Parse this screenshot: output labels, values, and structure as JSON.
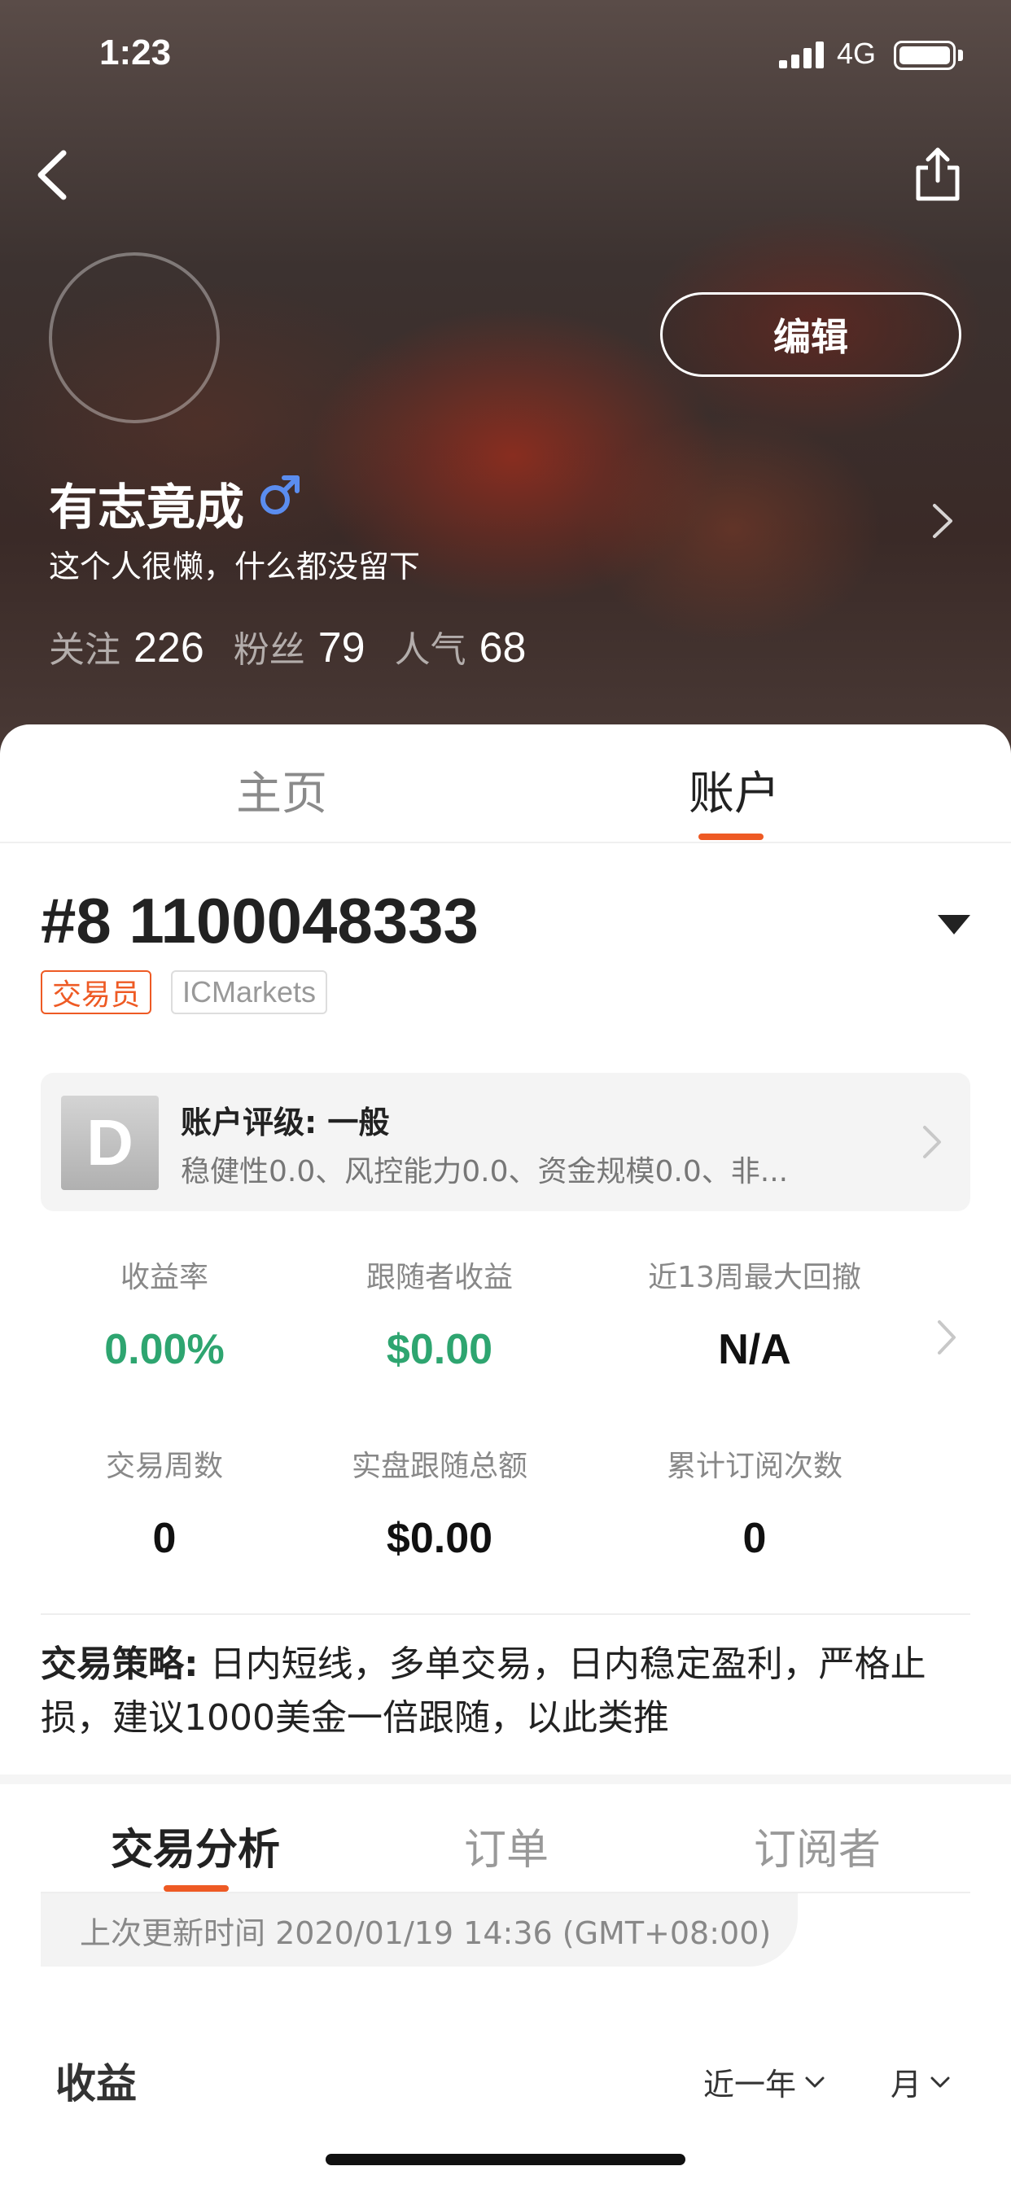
{
  "status_bar": {
    "time": "1:23",
    "network": "4G"
  },
  "profile": {
    "edit_label": "编辑",
    "name": "有志竟成",
    "bio": "这个人很懒，什么都没留下",
    "stats": [
      {
        "label": "关注",
        "value": "226"
      },
      {
        "label": "粉丝",
        "value": "79"
      },
      {
        "label": "人气",
        "value": "68"
      }
    ]
  },
  "main_tabs": {
    "home": "主页",
    "account": "账户",
    "active": "账户"
  },
  "account": {
    "id": "#8 1100048333",
    "role_badge": "交易员",
    "broker_badge": "ICMarkets",
    "rating": {
      "grade": "D",
      "title": "账户评级: 一般",
      "description": "稳健性0.0、风控能力0.0、资金规模0.0、非..."
    },
    "metrics": [
      {
        "label": "收益率",
        "value": "0.00%",
        "color": "#2ea570"
      },
      {
        "label": "跟随者收益",
        "value": "$0.00",
        "color": "#2ea570"
      },
      {
        "label": "近13周最大回撤",
        "value": "N/A",
        "color": "#111111"
      },
      {
        "label": "交易周数",
        "value": "0",
        "color": "#111111"
      },
      {
        "label": "实盘跟随总额",
        "value": "$0.00",
        "color": "#111111"
      },
      {
        "label": "累计订阅次数",
        "value": "0",
        "color": "#111111"
      }
    ],
    "strategy_label": "交易策略:",
    "strategy_text": " 日内短线，多单交易，日内稳定盈利，严格止损，建议1000美金一倍跟随，以此类推"
  },
  "sub_tabs": {
    "analysis": "交易分析",
    "orders": "订单",
    "subscribers": "订阅者",
    "active": "交易分析"
  },
  "update_text": "上次更新时间 2020/01/19 14:36 (GMT+08:00)",
  "earnings": {
    "title": "收益",
    "period_filter": "近一年",
    "granularity_filter": "月"
  },
  "colors": {
    "accent": "#ee5a24",
    "positive": "#2ea570",
    "gender": "#5b8def"
  },
  "icons": {
    "back": "chevron-left-icon",
    "share": "share-icon",
    "gender": "male-icon",
    "profile_arrow": "chevron-right-icon",
    "dropdown": "triangle-down-icon",
    "rating_arrow": "chevron-right-icon",
    "metrics_arrow": "chevron-right-icon",
    "filter_chevron": "chevron-down-icon"
  }
}
